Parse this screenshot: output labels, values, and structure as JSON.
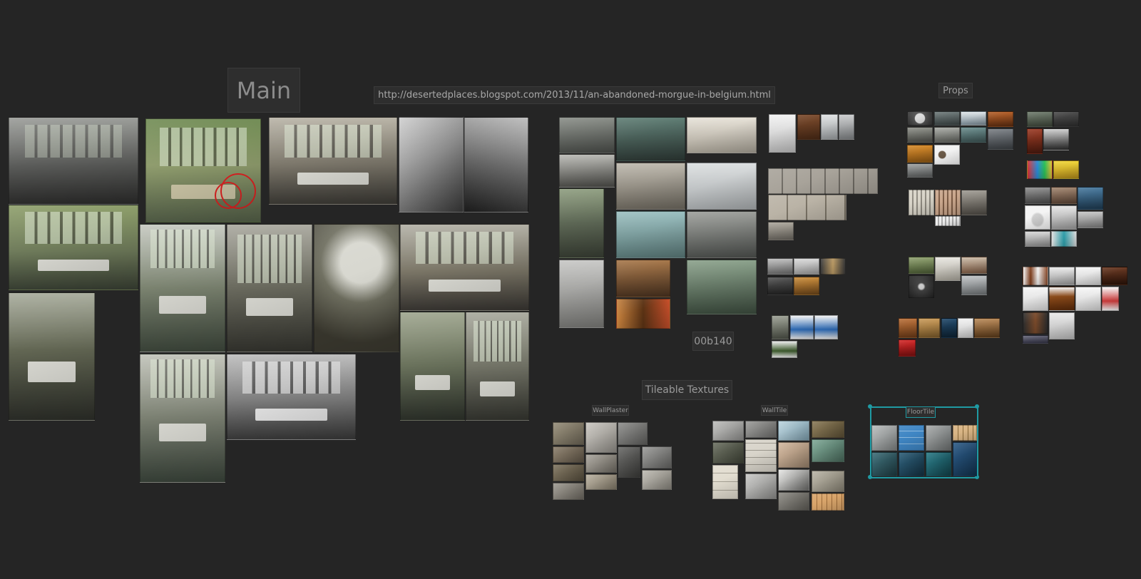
{
  "labels": {
    "main": "Main",
    "url": "http://desertedplaces.blogspot.com/2013/11/an-abandoned-morgue-in-belgium.html",
    "props": "Props",
    "hash": "00b140",
    "tileable": "Tileable Textures",
    "wallplaster": "WallPlaster",
    "walltile": "WallTile",
    "floortile": "FloorTile"
  },
  "colors": {
    "background": "#252525",
    "selection": "#1f9aa3",
    "annotation": "#dd2222"
  }
}
